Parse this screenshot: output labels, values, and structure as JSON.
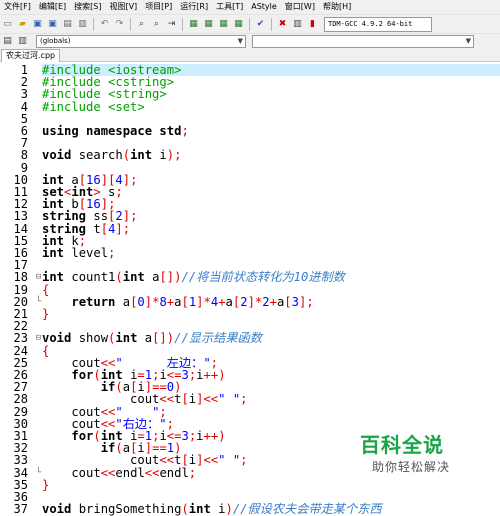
{
  "menu": [
    "文件[F]",
    "编辑[E]",
    "搜索[S]",
    "视图[V]",
    "项目[P]",
    "运行[R]",
    "工具[T]",
    "AStyle",
    "窗口[W]",
    "帮助[H]"
  ],
  "toolbar": {
    "compiler": "TDM-GCC 4.9.2 64-bit"
  },
  "scope": {
    "globals": "(globals)"
  },
  "tab": {
    "filename": "农夫过河.cpp"
  },
  "watermark": {
    "brand": "百科全说",
    "slogan": "助你轻松解决"
  },
  "code_lines": [
    "#include <iostream>",
    "#include <cstring>",
    "#include <string>",
    "#include <set>",
    "",
    "using namespace std;",
    "",
    "void search(int i);",
    "",
    "int a[16][4];",
    "set<int> s;",
    "int b[16];",
    "string ss[2];",
    "string t[4];",
    "int k;",
    "int level;",
    "",
    "int count1(int a[])//将当前状态转化为10进制数",
    "{",
    "    return a[0]*8+a[1]*4+a[2]*2+a[3];",
    "}",
    "",
    "void show(int a[])//显示结果函数",
    "{",
    "    cout<<\"      左边：\";",
    "    for(int i=1;i<=3;i++)",
    "        if(a[i]==0)",
    "            cout<<t[i]<<\" \";",
    "    cout<<\"    \";",
    "    cout<<\"右边：\";",
    "    for(int i=1;i<=3;i++)",
    "        if(a[i]==1)",
    "            cout<<t[i]<<\" \";",
    "    cout<<endl<<endl;",
    "}",
    "",
    "void bringSomething(int i)//假设农夫会带走某个东西"
  ]
}
